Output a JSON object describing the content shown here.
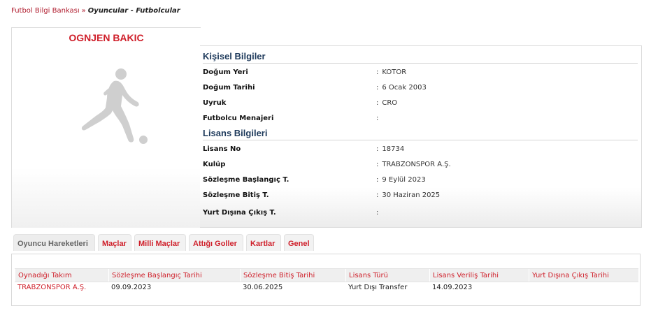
{
  "breadcrumb": {
    "root": "Futbol Bilgi Bankası",
    "separator": "»",
    "current": "Oyuncular - Futbolcular"
  },
  "player": {
    "name": "OGNJEN BAKIC"
  },
  "personal": {
    "title": "Kişisel Bilgiler",
    "rows": [
      {
        "label": "Doğum Yeri",
        "value": "KOTOR"
      },
      {
        "label": "Doğum Tarihi",
        "value": "6 Ocak 2003"
      },
      {
        "label": "Uyruk",
        "value": "CRO"
      },
      {
        "label": "Futbolcu Menajeri",
        "value": ""
      }
    ]
  },
  "license": {
    "title": "Lisans Bilgileri",
    "rows": [
      {
        "label": "Lisans No",
        "value": "18734"
      },
      {
        "label": "Kulüp",
        "value": "TRABZONSPOR A.Ş."
      },
      {
        "label": "Sözleşme Başlangıç T.",
        "value": "9 Eylül 2023"
      },
      {
        "label": "Sözleşme Bitiş T.",
        "value": "30 Haziran 2025"
      },
      {
        "label": "Yurt Dışına Çıkış T.",
        "value": ""
      }
    ]
  },
  "colon": ":",
  "tabs": [
    {
      "label": "Oyuncu Hareketleri",
      "active": true
    },
    {
      "label": "Maçlar"
    },
    {
      "label": "Milli Maçlar"
    },
    {
      "label": "Attığı Goller"
    },
    {
      "label": "Kartlar"
    },
    {
      "label": "Genel"
    }
  ],
  "table": {
    "headers": [
      "Oynadığı Takım",
      "Sözleşme Başlangıç Tarihi",
      "Sözleşme Bitiş Tarihi",
      "Lisans Türü",
      "Lisans Veriliş Tarihi",
      "Yurt Dışına Çıkış Tarihi"
    ],
    "rows": [
      {
        "team": "TRABZONSPOR A.Ş.",
        "start": "09.09.2023",
        "end": "30.06.2025",
        "type": "Yurt Dışı Transfer",
        "issued": "14.09.2023",
        "abroad": ""
      }
    ]
  },
  "colors": {
    "accent_red": "#cf1f2a",
    "title_blue": "#1f3b5c"
  },
  "icons": [
    "player-silhouette-icon"
  ]
}
